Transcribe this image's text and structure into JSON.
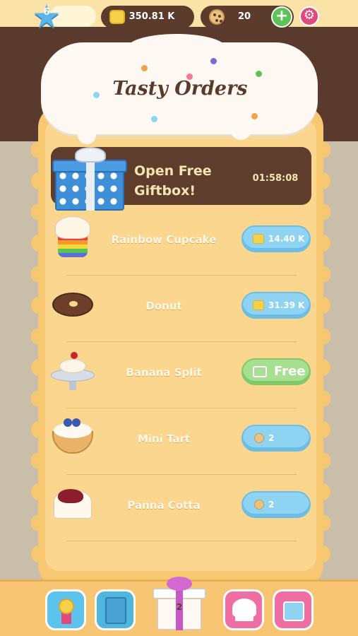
{
  "hud": {
    "level": "6",
    "coins": "350.81 K",
    "cookies": "20"
  },
  "header": {
    "title": "Tasty Orders"
  },
  "gift_banner": {
    "text": "Open Free Giftbox!",
    "timer": "01:58:08"
  },
  "orders": [
    {
      "name": "Rainbow Cupcake",
      "price": "14.40 K",
      "currency": "coin"
    },
    {
      "name": "Donut",
      "price": "31.39 K",
      "currency": "coin"
    },
    {
      "name": "Banana Split",
      "price": "Free",
      "currency": "video"
    },
    {
      "name": "Mini Tart",
      "price": "2",
      "currency": "cookie"
    },
    {
      "name": "Panna Cotta",
      "price": "2",
      "currency": "cookie"
    }
  ],
  "bottom_nav": {
    "gift_count": "2"
  },
  "colors": {
    "chocolate": "#5a3a2c",
    "panel": "#f7c872",
    "blue_button": "#8fd3f3",
    "green_button": "#a6e090",
    "pink_button": "#ef6ea3"
  },
  "icons": [
    "star-icon",
    "coin-icon",
    "cookie-icon",
    "plus-icon",
    "gear-icon",
    "giftbox-icon",
    "video-icon",
    "medal-icon",
    "recipe-book-icon",
    "chef-hat-icon",
    "shop-icon"
  ]
}
